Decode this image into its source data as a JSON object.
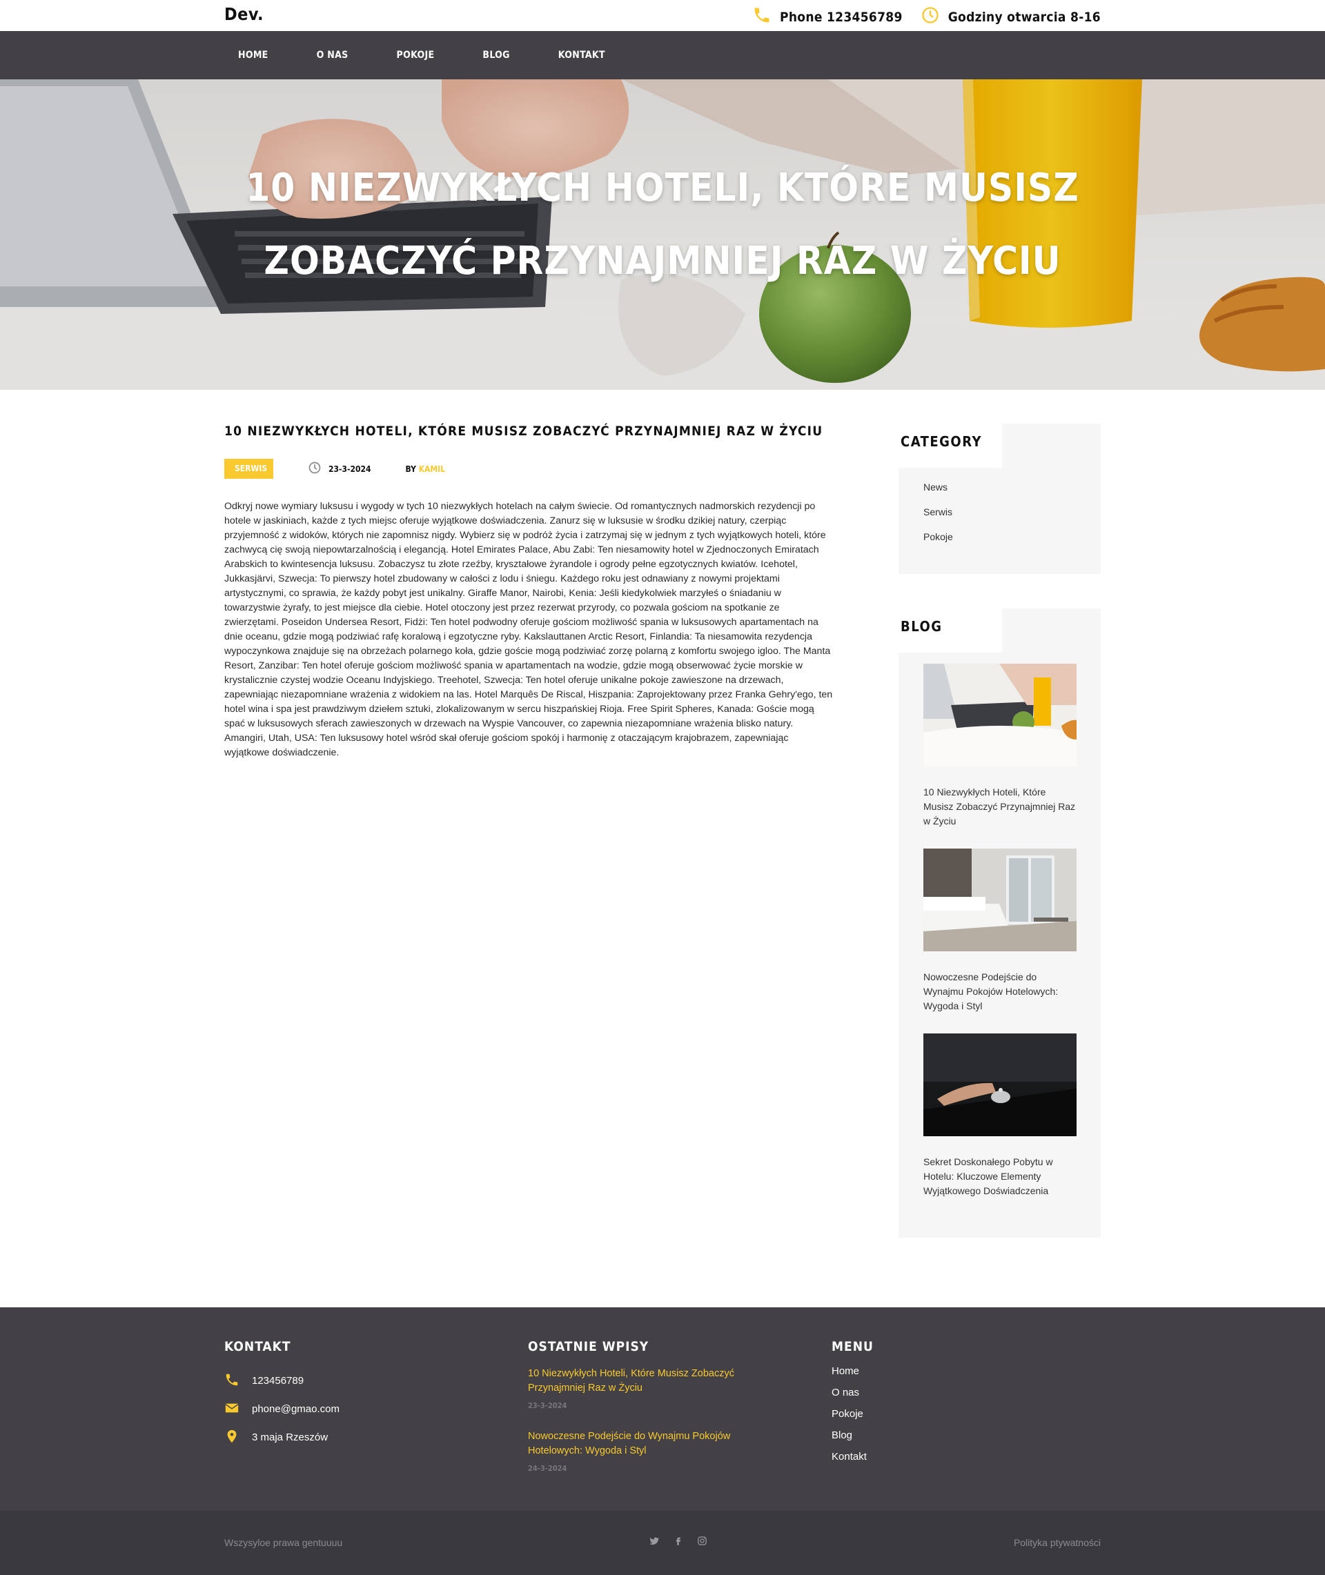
{
  "header": {
    "logo": "Dev.",
    "phone": "Phone 123456789",
    "hours": "Godziny otwarcia 8-16"
  },
  "nav": [
    "HOME",
    "O NAS",
    "POKOJE",
    "BLOG",
    "KONTAKT"
  ],
  "hero": {
    "title_line1": "10 NIEZWYKŁYCH HOTELI, KTÓRE MUSISZ",
    "title_line2": "ZOBACZYĆ PRZYNAJMNIEJ RAZ W ŻYCIU"
  },
  "article": {
    "title": "10 NIEZWYKŁYCH HOTELI, KTÓRE MUSISZ ZOBACZYĆ PRZYNAJMNIEJ RAZ W ŻYCIU",
    "category": "SERWIS",
    "date": "23-3-2024",
    "by": "BY ",
    "author": "KAMIL",
    "body": "Odkryj nowe wymiary luksusu i wygody w tych 10 niezwykłych hotelach na całym świecie. Od romantycznych nadmorskich rezydencji po hotele w jaskiniach, każde z tych miejsc oferuje wyjątkowe doświadczenia. Zanurz się w luksusie w środku dzikiej natury, czerpiąc przyjemność z widoków, których nie zapomnisz nigdy. Wybierz się w podróż życia i zatrzymaj się w jednym z tych wyjątkowych hoteli, które zachwycą cię swoją niepowtarzalnością i elegancją. Hotel Emirates Palace, Abu Zabi: Ten niesamowity hotel w Zjednoczonych Emiratach Arabskich to kwintesencja luksusu. Zobaczysz tu złote rzeźby, kryształowe żyrandole i ogrody pełne egzotycznych kwiatów. Icehotel, Jukkasjärvi, Szwecja: To pierwszy hotel zbudowany w całości z lodu i śniegu. Każdego roku jest odnawiany z nowymi projektami artystycznymi, co sprawia, że każdy pobyt jest unikalny. Giraffe Manor, Nairobi, Kenia: Jeśli kiedykolwiek marzyłeś o śniadaniu w towarzystwie żyrafy, to jest miejsce dla ciebie. Hotel otoczony jest przez rezerwat przyrody, co pozwala gościom na spotkanie ze zwierzętami. Poseidon Undersea Resort, Fidżi: Ten hotel podwodny oferuje gościom możliwość spania w luksusowych apartamentach na dnie oceanu, gdzie mogą podziwiać rafę koralową i egzotyczne ryby. Kakslauttanen Arctic Resort, Finlandia: Ta niesamowita rezydencja wypoczynkowa znajduje się na obrzeżach polarnego koła, gdzie goście mogą podziwiać zorzę polarną z komfortu swojego igloo. The Manta Resort, Zanzibar: Ten hotel oferuje gościom możliwość spania w apartamentach na wodzie, gdzie mogą obserwować życie morskie w krystalicznie czystej wodzie Oceanu Indyjskiego. Treehotel, Szwecja: Ten hotel oferuje unikalne pokoje zawieszone na drzewach, zapewniając niezapomniane wrażenia z widokiem na las. Hotel Marquês De Riscal, Hiszpania: Zaprojektowany przez Franka Gehry'ego, ten hotel wina i spa jest prawdziwym dziełem sztuki, zlokalizowanym w sercu hiszpańskiej Rioja. Free Spirit Spheres, Kanada: Goście mogą spać w luksusowych sferach zawieszonych w drzewach na Wyspie Vancouver, co zapewnia niezapomniane wrażenia blisko natury. Amangiri, Utah, USA: Ten luksusowy hotel wśród skał oferuje gościom spokój i harmonię z otaczającym krajobrazem, zapewniając wyjątkowe doświadczenie."
  },
  "sidebar": {
    "category_title": "CATEGORY",
    "categories": [
      "News",
      "Serwis",
      "Pokoje"
    ],
    "blog_title": "BLOG",
    "posts": [
      "10 Niezwykłych Hoteli, Które Musisz Zobaczyć Przynajmniej Raz w Życiu",
      "Nowoczesne Podejście do Wynajmu Pokojów Hotelowych: Wygoda i Styl",
      "Sekret Doskonałego Pobytu w Hotelu: Kluczowe Elementy Wyjątkowego Doświadczenia"
    ]
  },
  "footer": {
    "contact_title": "KONTAKT",
    "phone": "123456789",
    "email": "phone@gmao.com",
    "address": "3 maja Rzeszów",
    "recent_title": "OSTATNIE WPISY",
    "recent": [
      {
        "title": "10 Niezwykłych Hoteli, Które Musisz Zobaczyć Przynajmniej Raz w Życiu",
        "date": "23-3-2024"
      },
      {
        "title": "Nowoczesne Podejście do Wynajmu Pokojów Hotelowych: Wygoda i Styl",
        "date": "24-3-2024"
      }
    ],
    "menu_title": "MENU",
    "menu": [
      "Home",
      "O nas",
      "Pokoje",
      "Blog",
      "Kontakt"
    ],
    "copyright": "Wszysyloe prawa gentuuuu",
    "privacy": "Polityka ptywatności"
  },
  "colors": {
    "accent": "#f9c92f",
    "nav_bg": "#434146",
    "footer_bg": "#434146",
    "bottombar_bg": "#3a393d"
  },
  "icons": [
    "phone-icon",
    "clock-icon",
    "mail-icon",
    "location-icon",
    "twitter-icon",
    "facebook-icon",
    "instagram-icon"
  ]
}
